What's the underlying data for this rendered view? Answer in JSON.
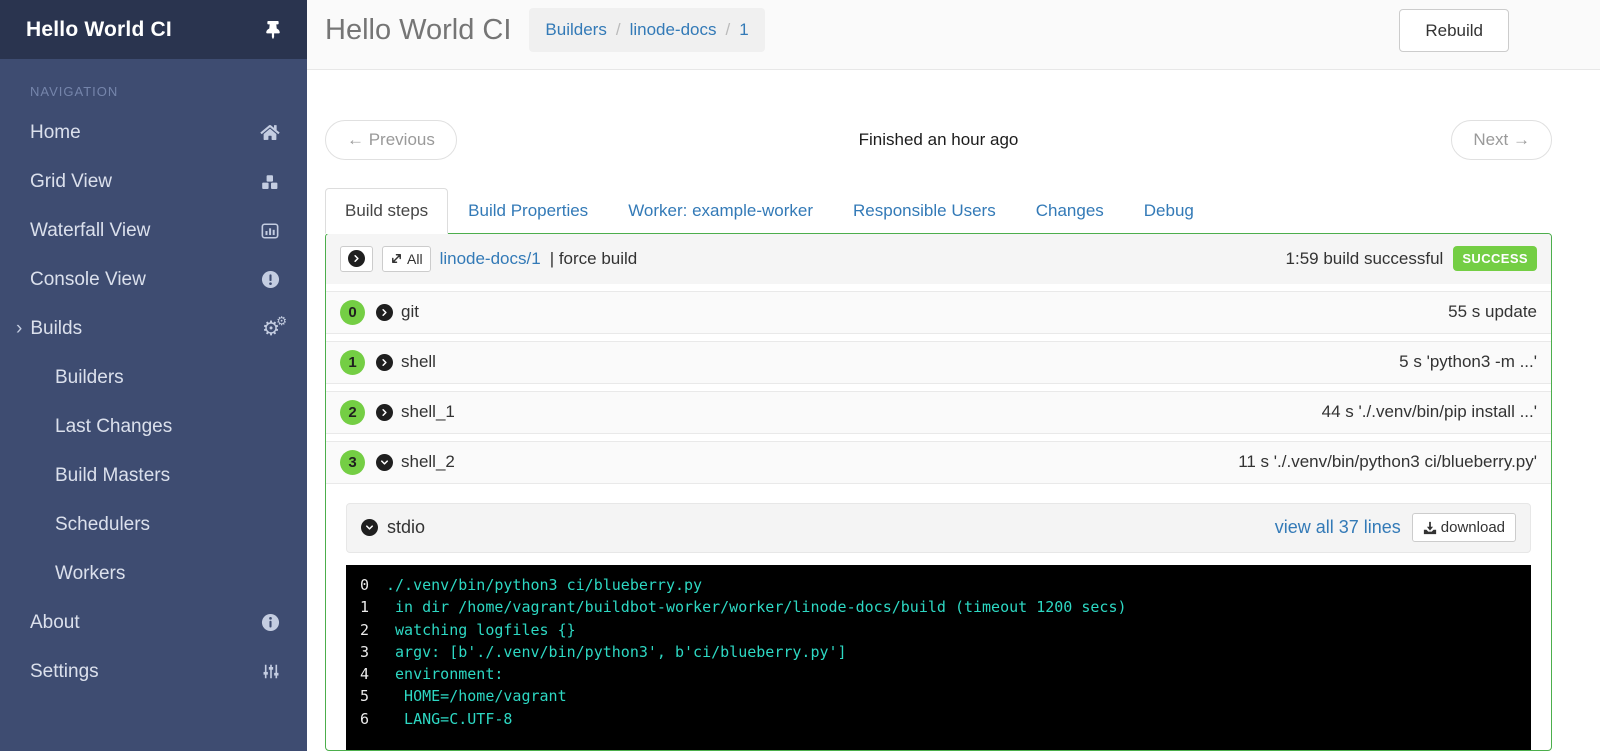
{
  "sidebar": {
    "title": "Hello World CI",
    "nav_label": "NAVIGATION",
    "items": [
      {
        "label": "Home",
        "icon": "home-icon"
      },
      {
        "label": "Grid View",
        "icon": "cubes-icon"
      },
      {
        "label": "Waterfall View",
        "icon": "bar-chart-icon"
      },
      {
        "label": "Console View",
        "icon": "exclamation-circle-icon"
      },
      {
        "label": "Builds",
        "icon": "cogs-icon",
        "caret": "›"
      }
    ],
    "sub_items": [
      "Builders",
      "Last Changes",
      "Build Masters",
      "Schedulers",
      "Workers"
    ],
    "bottom_items": [
      {
        "label": "About",
        "icon": "info-circle-icon"
      },
      {
        "label": "Settings",
        "icon": "sliders-icon"
      }
    ]
  },
  "header": {
    "title": "Hello World CI",
    "breadcrumbs": [
      "Builders",
      "linode-docs",
      "1"
    ],
    "rebuild_label": "Rebuild"
  },
  "toolbar": {
    "previous_label": "← Previous",
    "status_text": "Finished an hour ago",
    "next_label": "Next →"
  },
  "tabs": [
    {
      "label": "Build steps",
      "active": true
    },
    {
      "label": "Build Properties"
    },
    {
      "label": "Worker: example-worker"
    },
    {
      "label": "Responsible Users"
    },
    {
      "label": "Changes"
    },
    {
      "label": "Debug"
    }
  ],
  "build_panel": {
    "expand_all_label": "All",
    "build_link": "linode-docs/1",
    "reason": "| force build",
    "duration_status": "1:59 build successful",
    "result_badge": "SUCCESS",
    "steps": [
      {
        "number": "0",
        "name": "git",
        "detail": "55 s update"
      },
      {
        "number": "1",
        "name": "shell",
        "detail": "5 s 'python3 -m ...'"
      },
      {
        "number": "2",
        "name": "shell_1",
        "detail": "44 s './.venv/bin/pip install ...'"
      },
      {
        "number": "3",
        "name": "shell_2",
        "detail": "11 s './.venv/bin/python3 ci/blueberry.py'",
        "expanded": true
      }
    ]
  },
  "stdio": {
    "title": "stdio",
    "view_all_label": "view all 37 lines",
    "download_label": "download",
    "lines": [
      {
        "n": "0",
        "text": "./.venv/bin/python3 ci/blueberry.py"
      },
      {
        "n": "1",
        "text": " in dir /home/vagrant/buildbot-worker/worker/linode-docs/build (timeout 1200 secs)"
      },
      {
        "n": "2",
        "text": " watching logfiles {}"
      },
      {
        "n": "3",
        "text": " argv: [b'./.venv/bin/python3', b'ci/blueberry.py']"
      },
      {
        "n": "4",
        "text": " environment:"
      },
      {
        "n": "5",
        "text": "  HOME=/home/vagrant"
      },
      {
        "n": "6",
        "text": "  LANG=C.UTF-8"
      }
    ]
  },
  "colors": {
    "accent_blue": "#337ab7",
    "success_green": "#74ce44",
    "panel_border_green": "#4cae4c",
    "terminal_text_teal": "#2dd8c3",
    "sidebar_bg": "#3e4c71",
    "sidebar_header_bg": "#2a344f"
  }
}
